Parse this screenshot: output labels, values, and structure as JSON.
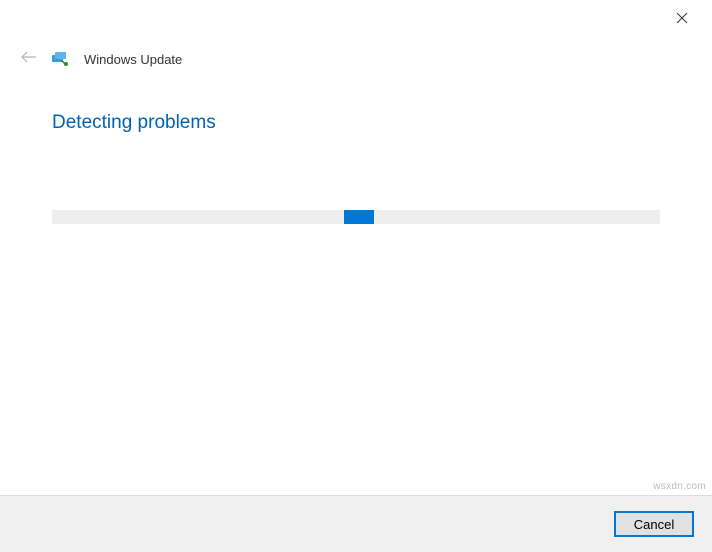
{
  "window": {
    "troubleshooter_name": "Windows Update",
    "heading": "Detecting problems"
  },
  "footer": {
    "cancel_label": "Cancel"
  },
  "watermark": "wsxdn.com",
  "colors": {
    "accent": "#0078d4",
    "heading": "#0063b1"
  }
}
